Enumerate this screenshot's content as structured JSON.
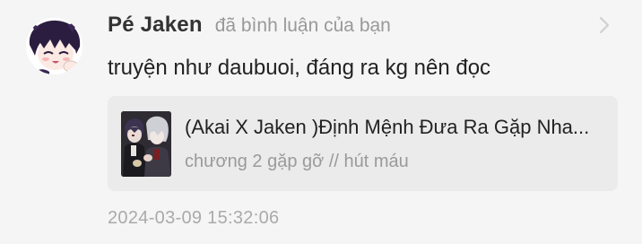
{
  "notification": {
    "user_name": "Pé Jaken",
    "action_text": "đã bình luận của bạn",
    "comment": "truyện như daubuoi, đáng ra kg nên đọc",
    "timestamp": "2024-03-09 15:32:06",
    "avatar_icon": "anime-character-avatar",
    "chevron_icon": "chevron-right-icon"
  },
  "story": {
    "title": "(Akai X Jaken )Định Mệnh Đưa Ra Gặp Nha...",
    "chapter": "chương 2 gặp gỡ // hút máu",
    "cover_icon": "story-cover-image"
  }
}
